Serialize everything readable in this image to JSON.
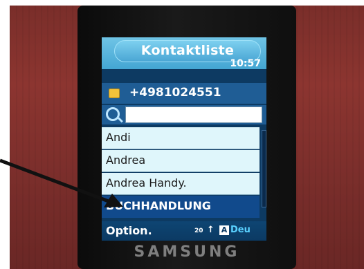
{
  "screen": {
    "title": "Kontaktliste",
    "clock": "10:57",
    "phone_number": "+4981024551",
    "search": {
      "value": ""
    },
    "contacts": [
      {
        "label": "Andi"
      },
      {
        "label": "Andrea"
      },
      {
        "label": "Andrea Handy."
      },
      {
        "label": "BUCHHANDLUNG",
        "selected": true
      }
    ],
    "softkey_left": "Option.",
    "indicators": {
      "input_count": "20",
      "arrow": "↑",
      "mode_letter": "A",
      "language": "Deu"
    }
  },
  "device": {
    "brand": "SAMSUNG"
  },
  "colors": {
    "title_bar": "#44a6d3",
    "header_band": "#1f5d95",
    "list_bg": "#dff6fb",
    "selected_row": "#114a8c",
    "softkey_bar": "#0b3a63"
  },
  "icons": {
    "sim": "sim-card-icon",
    "search": "search-icon",
    "arrow": "annotation-arrow"
  }
}
